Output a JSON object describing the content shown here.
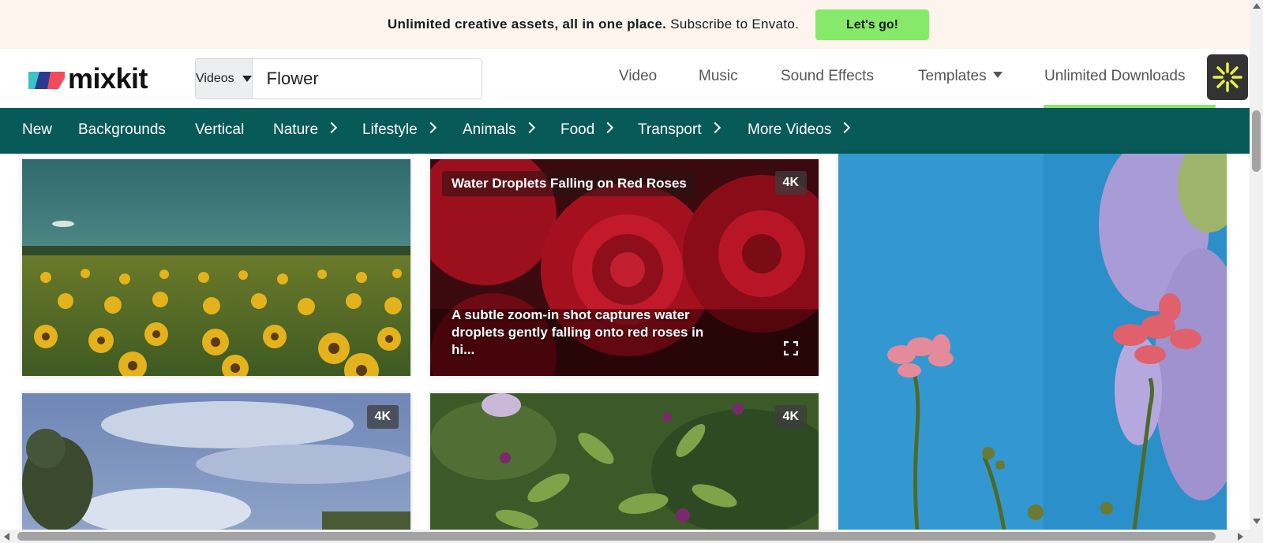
{
  "promo": {
    "bold_text": "Unlimited creative assets, all in one place.",
    "text": " Subscribe to Envato.",
    "button_label": "Let's go!"
  },
  "header": {
    "logo_text": "mixkit",
    "search_type": "Videos",
    "search_value": "Flower",
    "clear_symbol": "✕",
    "nav": [
      {
        "label": "Video"
      },
      {
        "label": "Music"
      },
      {
        "label": "Sound Effects"
      },
      {
        "label": "Templates"
      },
      {
        "label": "Unlimited Downloads"
      }
    ],
    "extension_icon": "sun-burst-icon"
  },
  "categories": [
    {
      "label": "New"
    },
    {
      "label": "Backgrounds"
    },
    {
      "label": "Vertical"
    },
    {
      "label": "Nature"
    },
    {
      "label": "Lifestyle"
    },
    {
      "label": "Animals"
    },
    {
      "label": "Food"
    },
    {
      "label": "Transport"
    },
    {
      "label": "More Videos"
    }
  ],
  "videos": [
    {
      "subject": "sunflower-field",
      "badge": ""
    },
    {
      "subject": "red-roses",
      "title": "Water Droplets Falling on Red Roses",
      "badge": "4K",
      "description": "A subtle zoom-in shot captures water droplets gently falling onto red roses in hi..."
    },
    {
      "subject": "pink-flowers-sky",
      "badge": ""
    },
    {
      "subject": "cloudy-sky-trees",
      "badge": "4K"
    },
    {
      "subject": "green-plant-buds",
      "badge": "4K"
    }
  ],
  "colors": {
    "promo_bg": "#fdf4ee",
    "accent_green": "#87e96a",
    "category_bar": "#075a58"
  }
}
